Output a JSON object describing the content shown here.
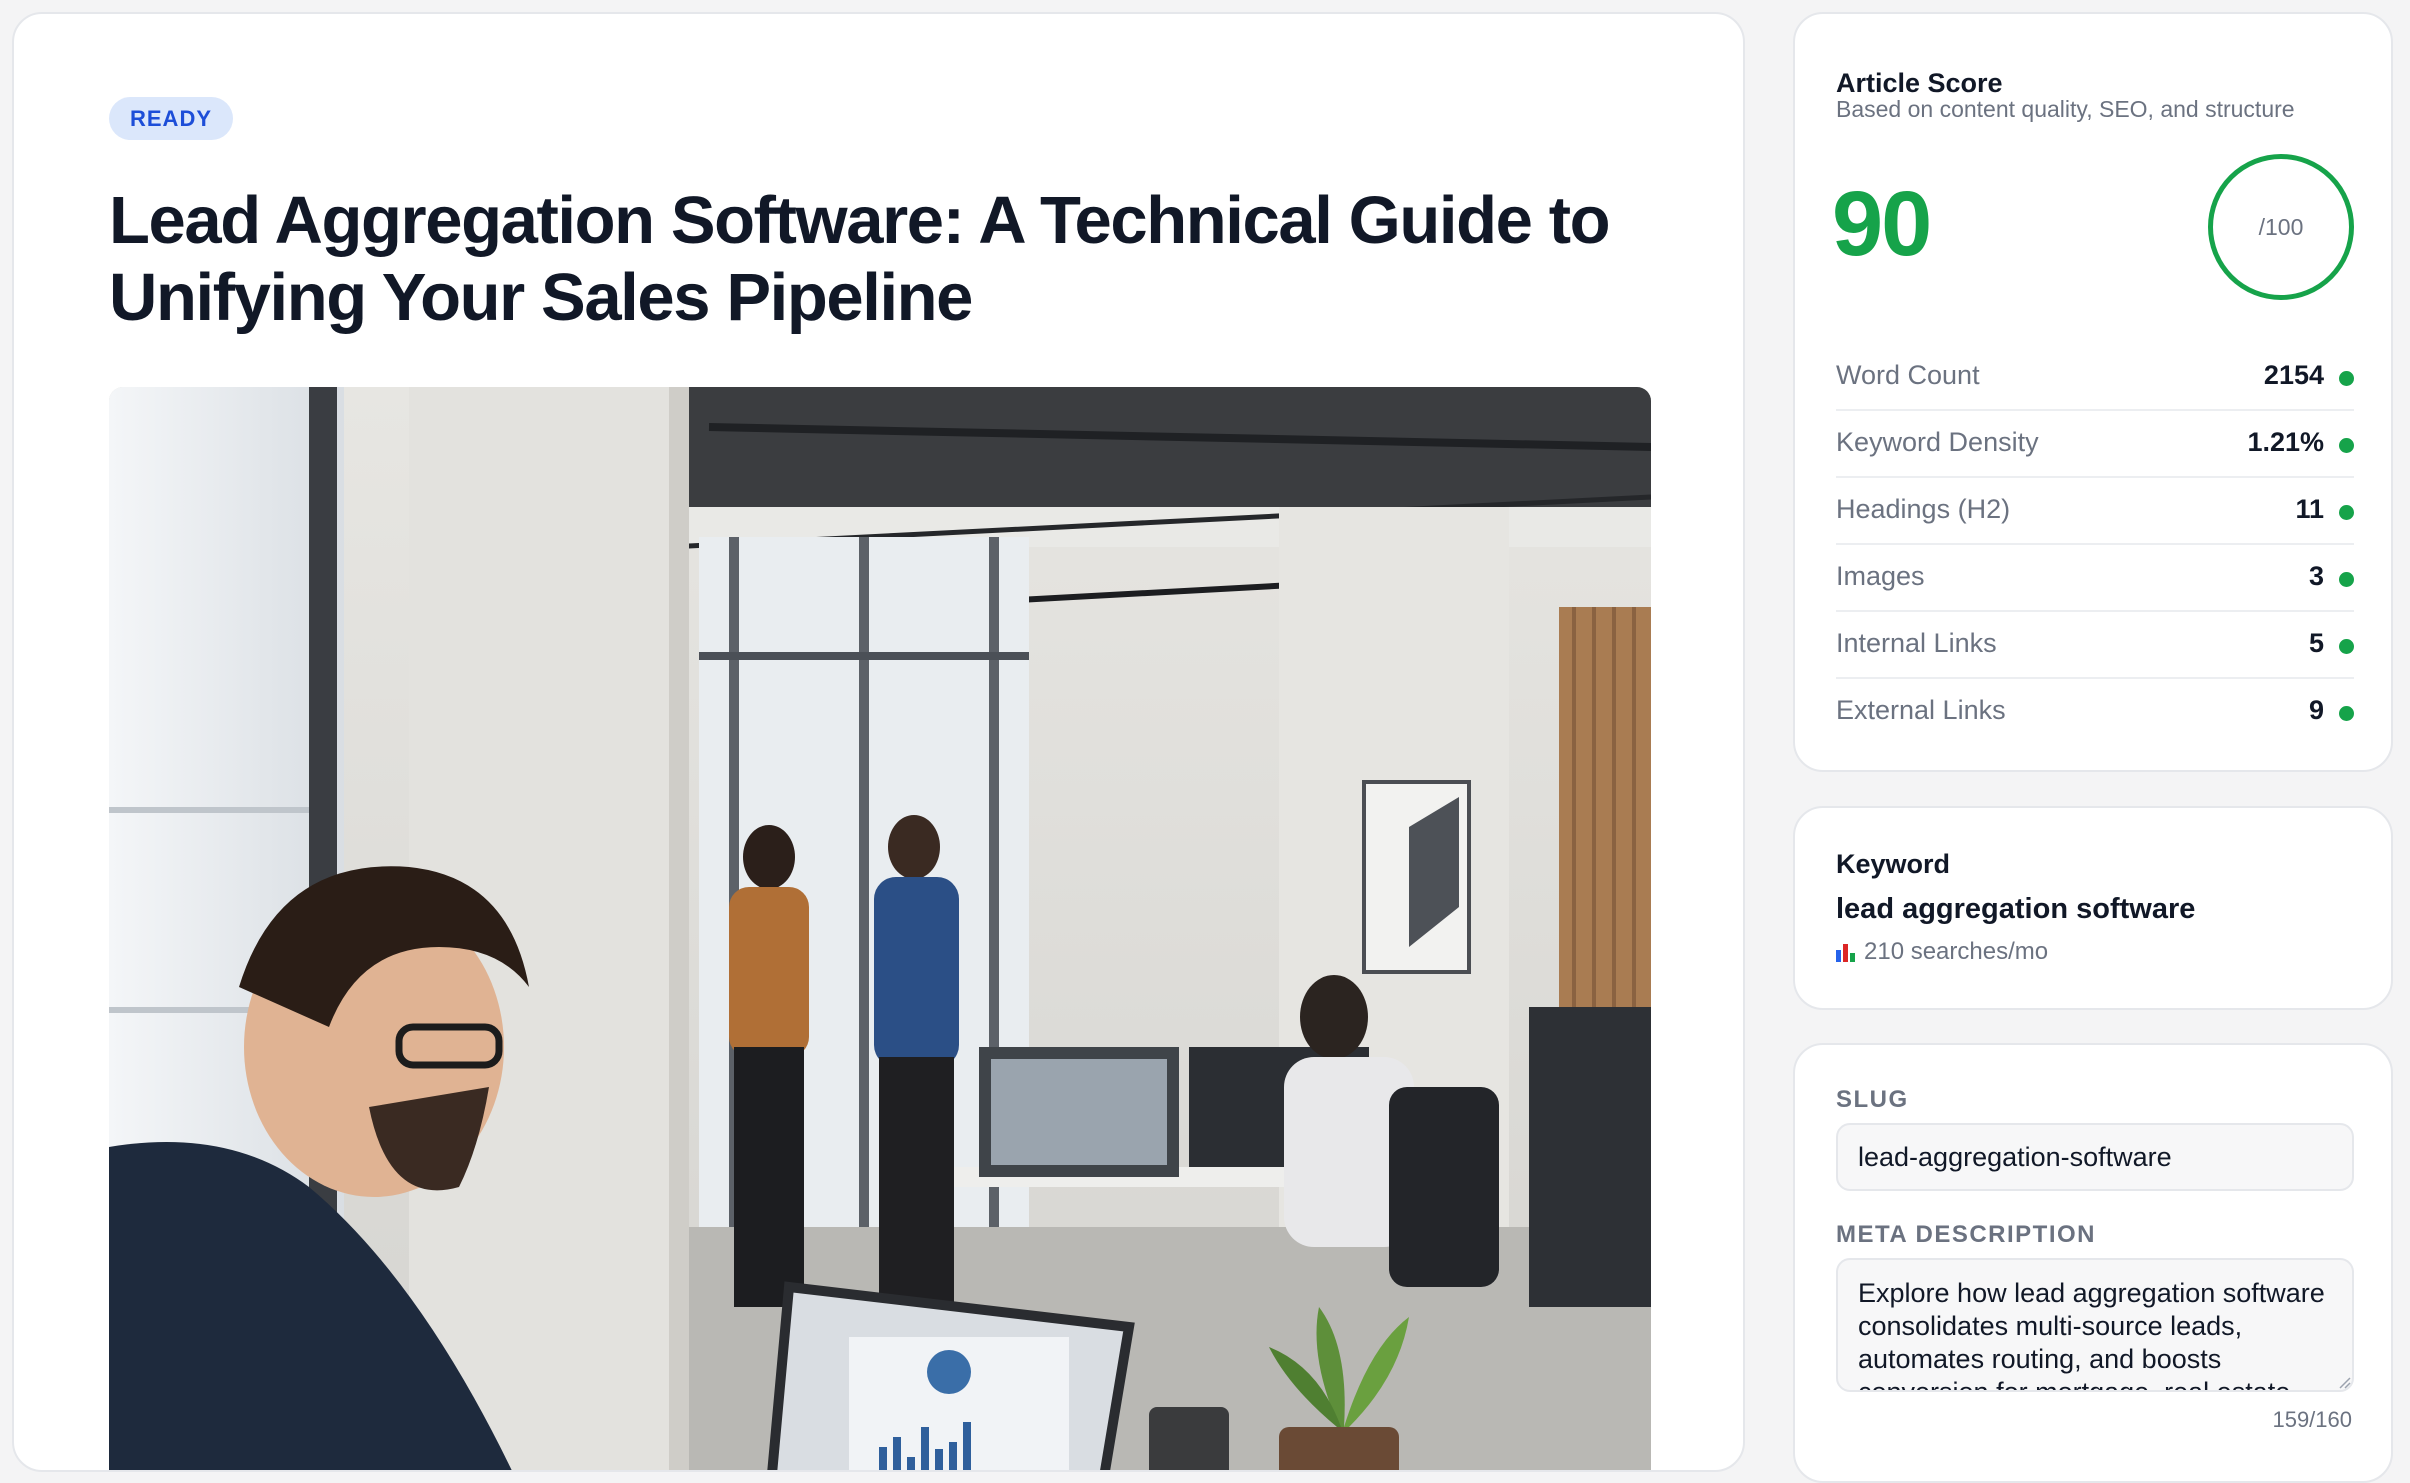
{
  "article": {
    "status": "READY",
    "title": "Lead Aggregation Software: A Technical Guide to Unifying Your Sales Pipeline"
  },
  "score": {
    "title": "Article Score",
    "subtitle": "Based on content quality, SEO, and structure",
    "value": "90",
    "max_label": "/100",
    "metrics": [
      {
        "label": "Word Count",
        "value": "2154"
      },
      {
        "label": "Keyword Density",
        "value": "1.21%"
      },
      {
        "label": "Headings (H2)",
        "value": "11"
      },
      {
        "label": "Images",
        "value": "3"
      },
      {
        "label": "Internal Links",
        "value": "5"
      },
      {
        "label": "External Links",
        "value": "9"
      }
    ],
    "status_color": "#16a34a"
  },
  "keyword": {
    "label": "Keyword",
    "value": "lead aggregation software",
    "volume": "210 searches/mo",
    "icon": "bar-chart-icon"
  },
  "seo": {
    "slug_label": "SLUG",
    "slug_value": "lead-aggregation-software",
    "meta_label": "META DESCRIPTION",
    "meta_value": "Explore how lead aggregation software consolidates multi-source leads, automates routing, and boosts conversion for mortgage, real estate",
    "char_count": "159/160"
  },
  "colors": {
    "accent_green": "#16a34a",
    "badge_bg": "#dbe7fb",
    "badge_text": "#1d4ed8"
  }
}
